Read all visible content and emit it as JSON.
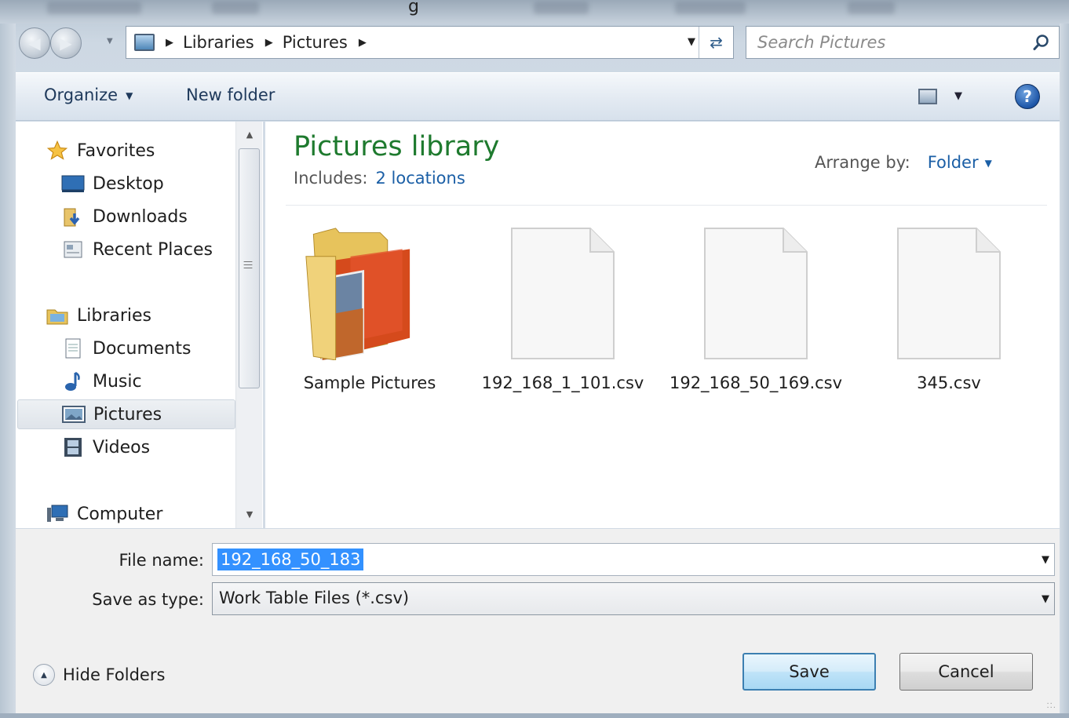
{
  "window": {
    "title_partial": "g"
  },
  "address_bar": {
    "breadcrumbs": [
      "Libraries",
      "Pictures"
    ],
    "icon": "library-icon"
  },
  "search": {
    "placeholder": "Search Pictures",
    "icon": "search-icon"
  },
  "toolbar": {
    "organize_label": "Organize",
    "new_folder_label": "New folder",
    "view_icon": "view-icon",
    "help_icon": "help-icon",
    "help_symbol": "?"
  },
  "nav_pane": {
    "favorites": {
      "label": "Favorites",
      "items": [
        {
          "label": "Desktop",
          "icon": "desktop-icon"
        },
        {
          "label": "Downloads",
          "icon": "downloads-icon"
        },
        {
          "label": "Recent Places",
          "icon": "recent-places-icon"
        }
      ]
    },
    "libraries": {
      "label": "Libraries",
      "items": [
        {
          "label": "Documents",
          "icon": "documents-icon"
        },
        {
          "label": "Music",
          "icon": "music-icon"
        },
        {
          "label": "Pictures",
          "icon": "pictures-icon",
          "selected": true
        },
        {
          "label": "Videos",
          "icon": "videos-icon"
        }
      ]
    },
    "computer": {
      "label": "Computer",
      "icon": "computer-icon"
    }
  },
  "content": {
    "title": "Pictures library",
    "includes_label": "Includes:",
    "includes_link": "2 locations",
    "arrange_label": "Arrange by:",
    "arrange_value": "Folder",
    "items": [
      {
        "label": "Sample Pictures",
        "type": "folder"
      },
      {
        "label": "192_168_1_101.csv",
        "type": "file"
      },
      {
        "label": "192_168_50_169.csv",
        "type": "file"
      },
      {
        "label": "345.csv",
        "type": "file"
      }
    ]
  },
  "form": {
    "file_name_label": "File name:",
    "file_name_value": "192_168_50_183",
    "save_type_label": "Save as type:",
    "save_type_value": "Work Table Files (*.csv)"
  },
  "buttons": {
    "hide_folders": "Hide Folders",
    "save": "Save",
    "cancel": "Cancel"
  },
  "colors": {
    "library_title": "#1e7a2e",
    "link": "#1b5fa6",
    "selection": "#3391ff"
  }
}
